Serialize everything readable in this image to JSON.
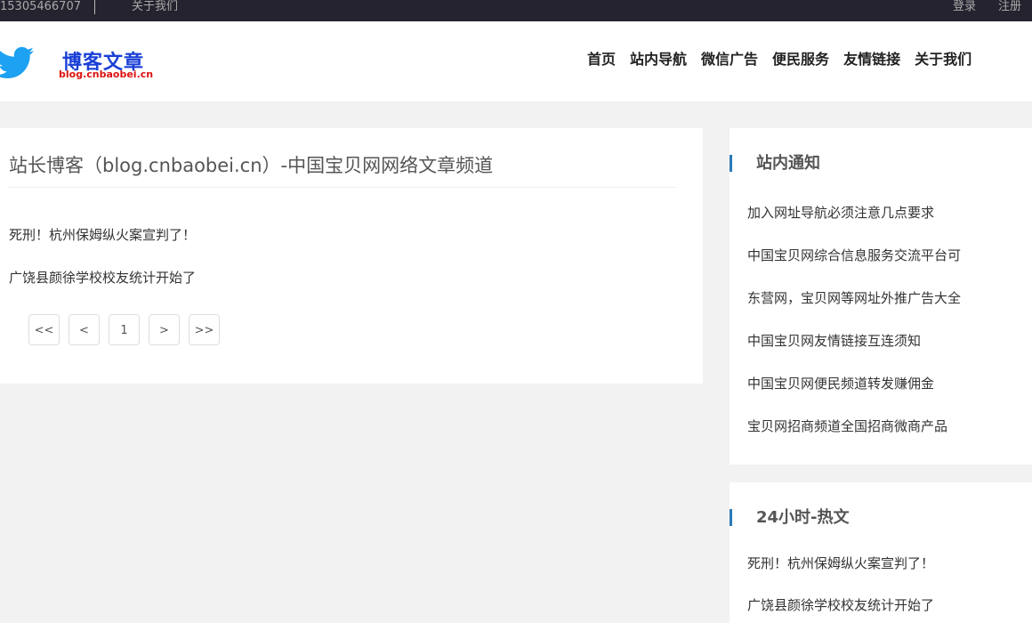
{
  "topbar": {
    "phone": "15305466707",
    "about": "关于我们",
    "login": "登录",
    "register": "注册"
  },
  "header": {
    "logo_title": "博客文章",
    "logo_subtitle": "blog.cnbaobei.cn",
    "logo_icon": "twitter-bird-icon",
    "nav": [
      "首页",
      "站内导航",
      "微信广告",
      "便民服务",
      "友情链接",
      "关于我们"
    ]
  },
  "main": {
    "title": "站长博客（blog.cnbaobei.cn）-中国宝贝网网络文章频道",
    "posts": [
      "死刑！杭州保姆纵火案宣判了！",
      "广饶县颜徐学校校友统计开始了"
    ],
    "pagination": [
      "<<",
      "<",
      "1",
      ">",
      ">>"
    ]
  },
  "sidebar": {
    "notice": {
      "heading": "站内通知",
      "items": [
        "加入网址导航必须注意几点要求",
        "中国宝贝网综合信息服务交流平台可",
        "东营网，宝贝网等网址外推广告大全",
        "中国宝贝网友情链接互连须知",
        "中国宝贝网便民频道转发赚佣金",
        "宝贝网招商频道全国招商微商产品"
      ]
    },
    "hot": {
      "heading": "24小时-热文",
      "items": [
        "死刑！杭州保姆纵火案宣判了！",
        "广饶县颜徐学校校友统计开始了"
      ]
    }
  },
  "colors": {
    "topbar_bg": "#24232f",
    "accent_blue": "#2a7ab8",
    "logo_blue": "#1a3fd6",
    "logo_red": "#dd1111",
    "page_bg": "#f2f2f2"
  }
}
